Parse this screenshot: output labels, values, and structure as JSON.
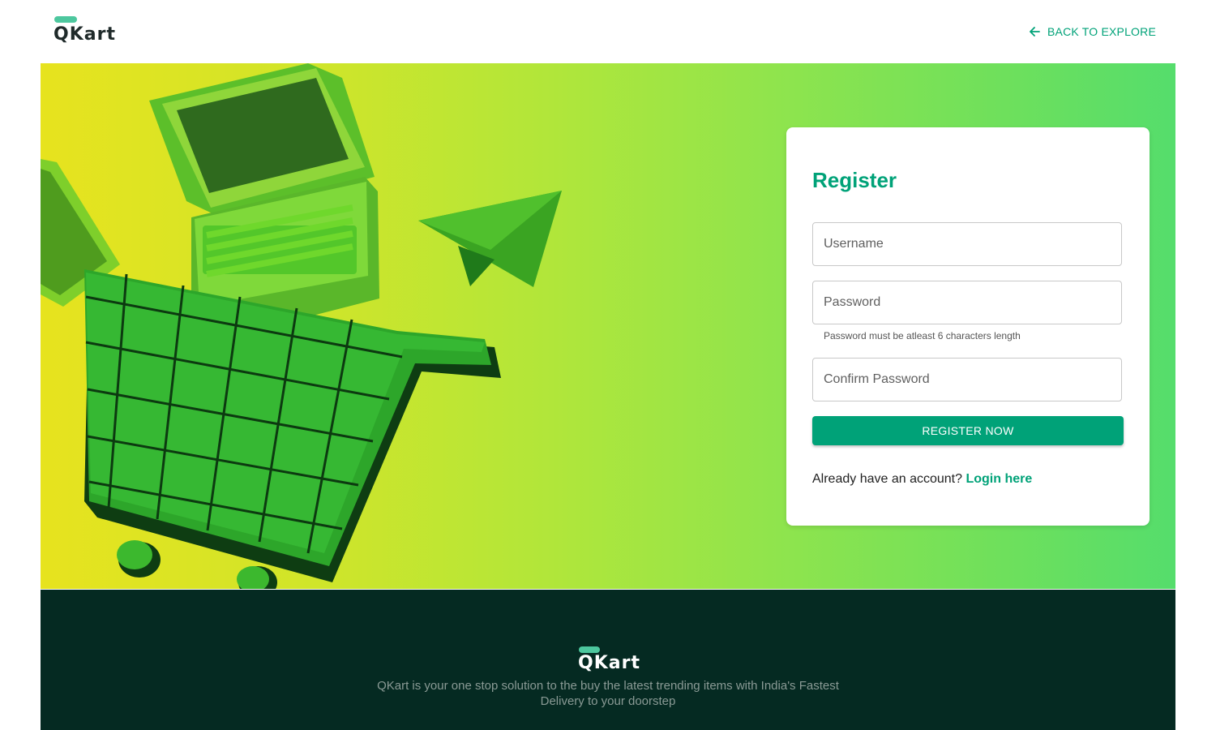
{
  "header": {
    "logo_text": "QKart",
    "back_link_label": "BACK TO EXPLORE"
  },
  "register": {
    "title": "Register",
    "username_placeholder": "Username",
    "password_placeholder": "Password",
    "password_helper": "Password must be atleast 6 characters length",
    "confirm_password_placeholder": "Confirm Password",
    "submit_label": "REGISTER NOW",
    "login_prompt": "Already have an account?",
    "login_link": "Login here"
  },
  "footer": {
    "logo_text": "QKart",
    "tagline": "QKart is your one stop solution to the buy the latest trending items with India's Fastest Delivery to your doorstep"
  },
  "colors": {
    "brand": "#00a278",
    "logo_accent": "#4dc79e",
    "footer_bg": "#052a22",
    "hero_gradient_start": "#e7e31e",
    "hero_gradient_end": "#55dd6c"
  },
  "icons": {
    "back": "arrow-left-icon"
  }
}
